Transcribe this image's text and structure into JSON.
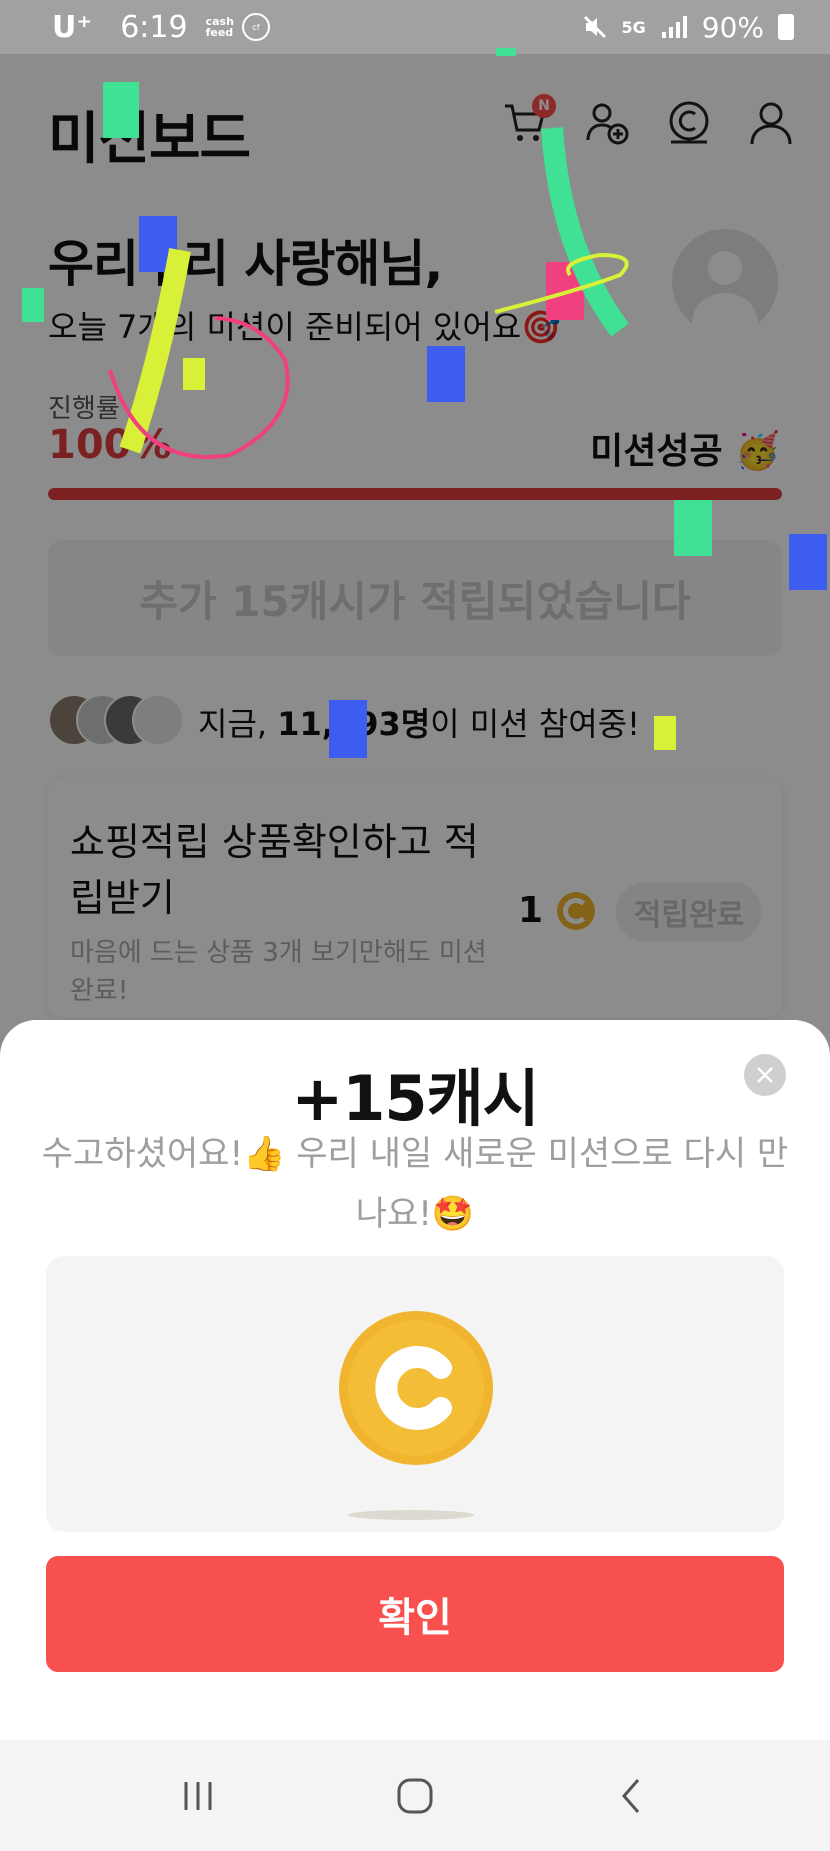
{
  "status_bar": {
    "carrier": "U⁺",
    "time": "6:19",
    "app_label": "cash feed",
    "network": "5G",
    "battery": "90%"
  },
  "header": {
    "title": "미션보드",
    "cart_badge": "N"
  },
  "greeting": {
    "title": "우리우리 사랑해님,",
    "subtitle": "오늘 7개의 미션이 준비되어 있어요🎯"
  },
  "progress": {
    "label": "진행률",
    "value_text": "100%",
    "value": 1.0,
    "status": "미션성공 🥳",
    "fill_color": "#e03c3c"
  },
  "reward_banner": {
    "text": "추가 15캐시가 적립되었습니다"
  },
  "participants": {
    "prefix": "지금, ",
    "count": "11,993명",
    "suffix": "이 미션 참여중!"
  },
  "mission_card": {
    "title": "쇼핑적립 상품확인하고 적립받기",
    "description": "마음에 드는 상품 3개 보기만해도 미션완료!",
    "reward": "1",
    "button": "적립완료"
  },
  "sheet": {
    "title": "+15캐시",
    "message": "수고하셨어요!👍 우리 내일 새로운 미션으로 다시 만나요!🤩",
    "confirm": "확인",
    "accent_color": "#f84f4f",
    "coin_color": "#f1b42f"
  },
  "icons": {
    "header": [
      "cart-icon",
      "add-friend-icon",
      "cash-coin-icon",
      "profile-icon"
    ],
    "nav": [
      "recent-apps-icon",
      "home-icon",
      "back-icon"
    ]
  }
}
